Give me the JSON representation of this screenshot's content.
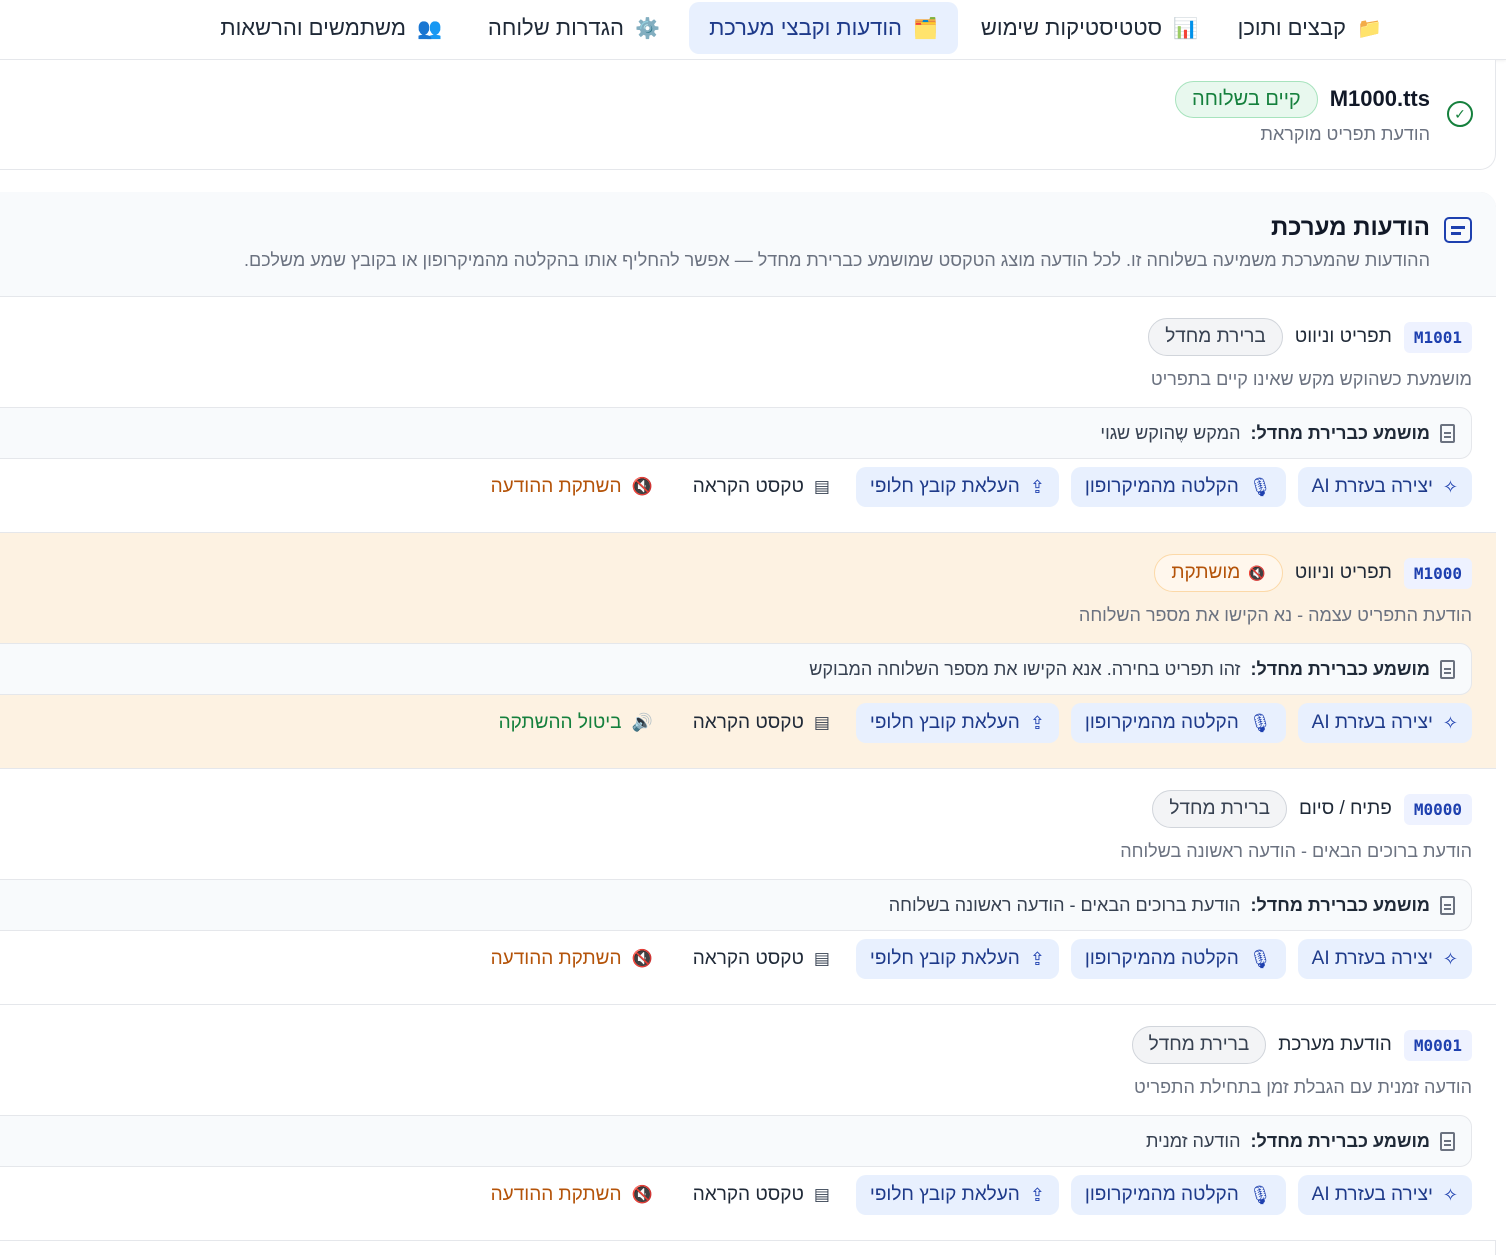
{
  "tabs": [
    {
      "label": "קבצים ותוכן",
      "icon": "folder-icon",
      "glyph": "📁"
    },
    {
      "label": "סטטיסטיקות שימוש",
      "icon": "bar-chart-icon",
      "glyph": "📊"
    },
    {
      "label": "הודעות וקבצי מערכת",
      "icon": "folder-icon",
      "glyph": "🗂️",
      "active": true
    },
    {
      "label": "הגדרות שלוחה",
      "icon": "gear-icon",
      "glyph": "⚙️"
    },
    {
      "label": "משתמשים והרשאות",
      "icon": "users-icon",
      "glyph": "👥"
    }
  ],
  "file": {
    "name": "M1000.tts",
    "status": "קיים בשלוחה",
    "description": "הודעת תפריט מוקראת"
  },
  "section": {
    "title": "הודעות מערכת",
    "subtitle": "ההודעות שהמערכת משמיעה בשלוחה זו. לכל הודעה מוצג הטקסט שמושמע כברירת מחדל — אפשר להחליף אותו בהקלטה מהמיקרופון או בקובץ שמע משלכם."
  },
  "labels": {
    "tts_prefix": "מושמע כברירת מחדל:",
    "ai": "יצירה בעזרת AI",
    "record": "הקלטה מהמיקרופון",
    "upload": "העלאת קובץ חלופי",
    "read_text": "טקסט הקראה",
    "mute": "השתקת ההודעה",
    "unmute": "ביטול ההשתקה"
  },
  "messages": [
    {
      "code": "M1001",
      "category": "תפריט וניווט",
      "pill": "ברירת מחדל",
      "muted": false,
      "description": "מושמעת כשהוקש מקש שאינו קיים בתפריט",
      "tts": "המקש שֶהוקש שגוי"
    },
    {
      "code": "M1000",
      "category": "תפריט וניווט",
      "pill": "מושתקת",
      "muted": true,
      "description": "הודעת התפריט עצמה - נא הקישו את מספר השלוחה",
      "tts": "זהו תפריט בחירה. אנא הקישו את מספר השלוחה המבוקש"
    },
    {
      "code": "M0000",
      "category": "פתיח / סיום",
      "pill": "ברירת מחדל",
      "muted": false,
      "description": "הודעת ברוכים הבאים - הודעה ראשונה בשלוחה",
      "tts": "הודעת ברוכים הבאים - הודעה ראשונה בשלוחה"
    },
    {
      "code": "M0001",
      "category": "הודעת מערכת",
      "pill": "ברירת מחדל",
      "muted": false,
      "description": "הודעה זמנית עם הגבלת זמן בתחילת התפריט",
      "tts": "הודעה זמנית"
    }
  ]
}
